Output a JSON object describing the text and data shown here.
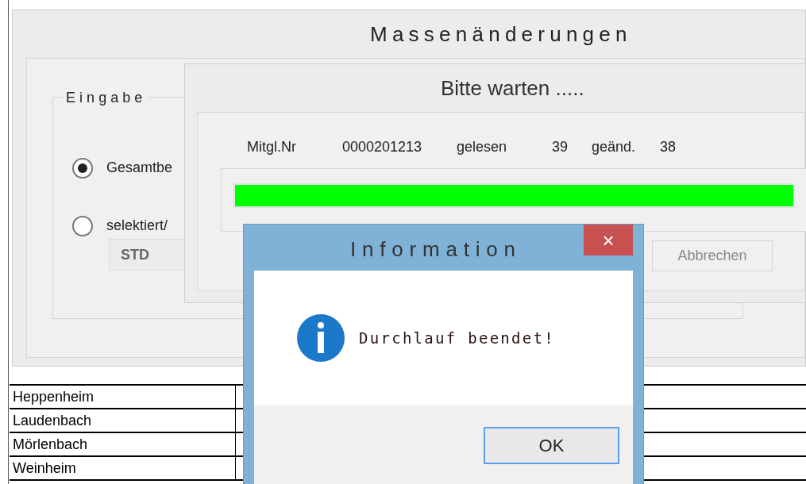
{
  "background_table": {
    "rows": [
      {
        "column_1": "Heppenheim"
      },
      {
        "column_1": "Laudenbach"
      },
      {
        "column_1": "Mörlenbach"
      },
      {
        "column_1": "Weinheim"
      }
    ]
  },
  "main_window": {
    "title": "Massenänderungen",
    "group": {
      "title": "Eingabe",
      "radios": [
        {
          "label": "Gesamtbe",
          "selected": true
        },
        {
          "label": "selektiert/",
          "selected": false
        }
      ],
      "field": {
        "value": "STD"
      }
    }
  },
  "progress_window": {
    "title": "Bitte warten .....",
    "status": [
      "Mitgl.Nr",
      "0000201213",
      "gelesen",
      "39",
      "geänd.",
      "38"
    ],
    "progress": {
      "level": 1
    },
    "cancel_button": "Abbrechen"
  },
  "dialog": {
    "title": "Information",
    "close": "×",
    "message": "Durchlauf beendet!",
    "ok_button": "OK"
  }
}
